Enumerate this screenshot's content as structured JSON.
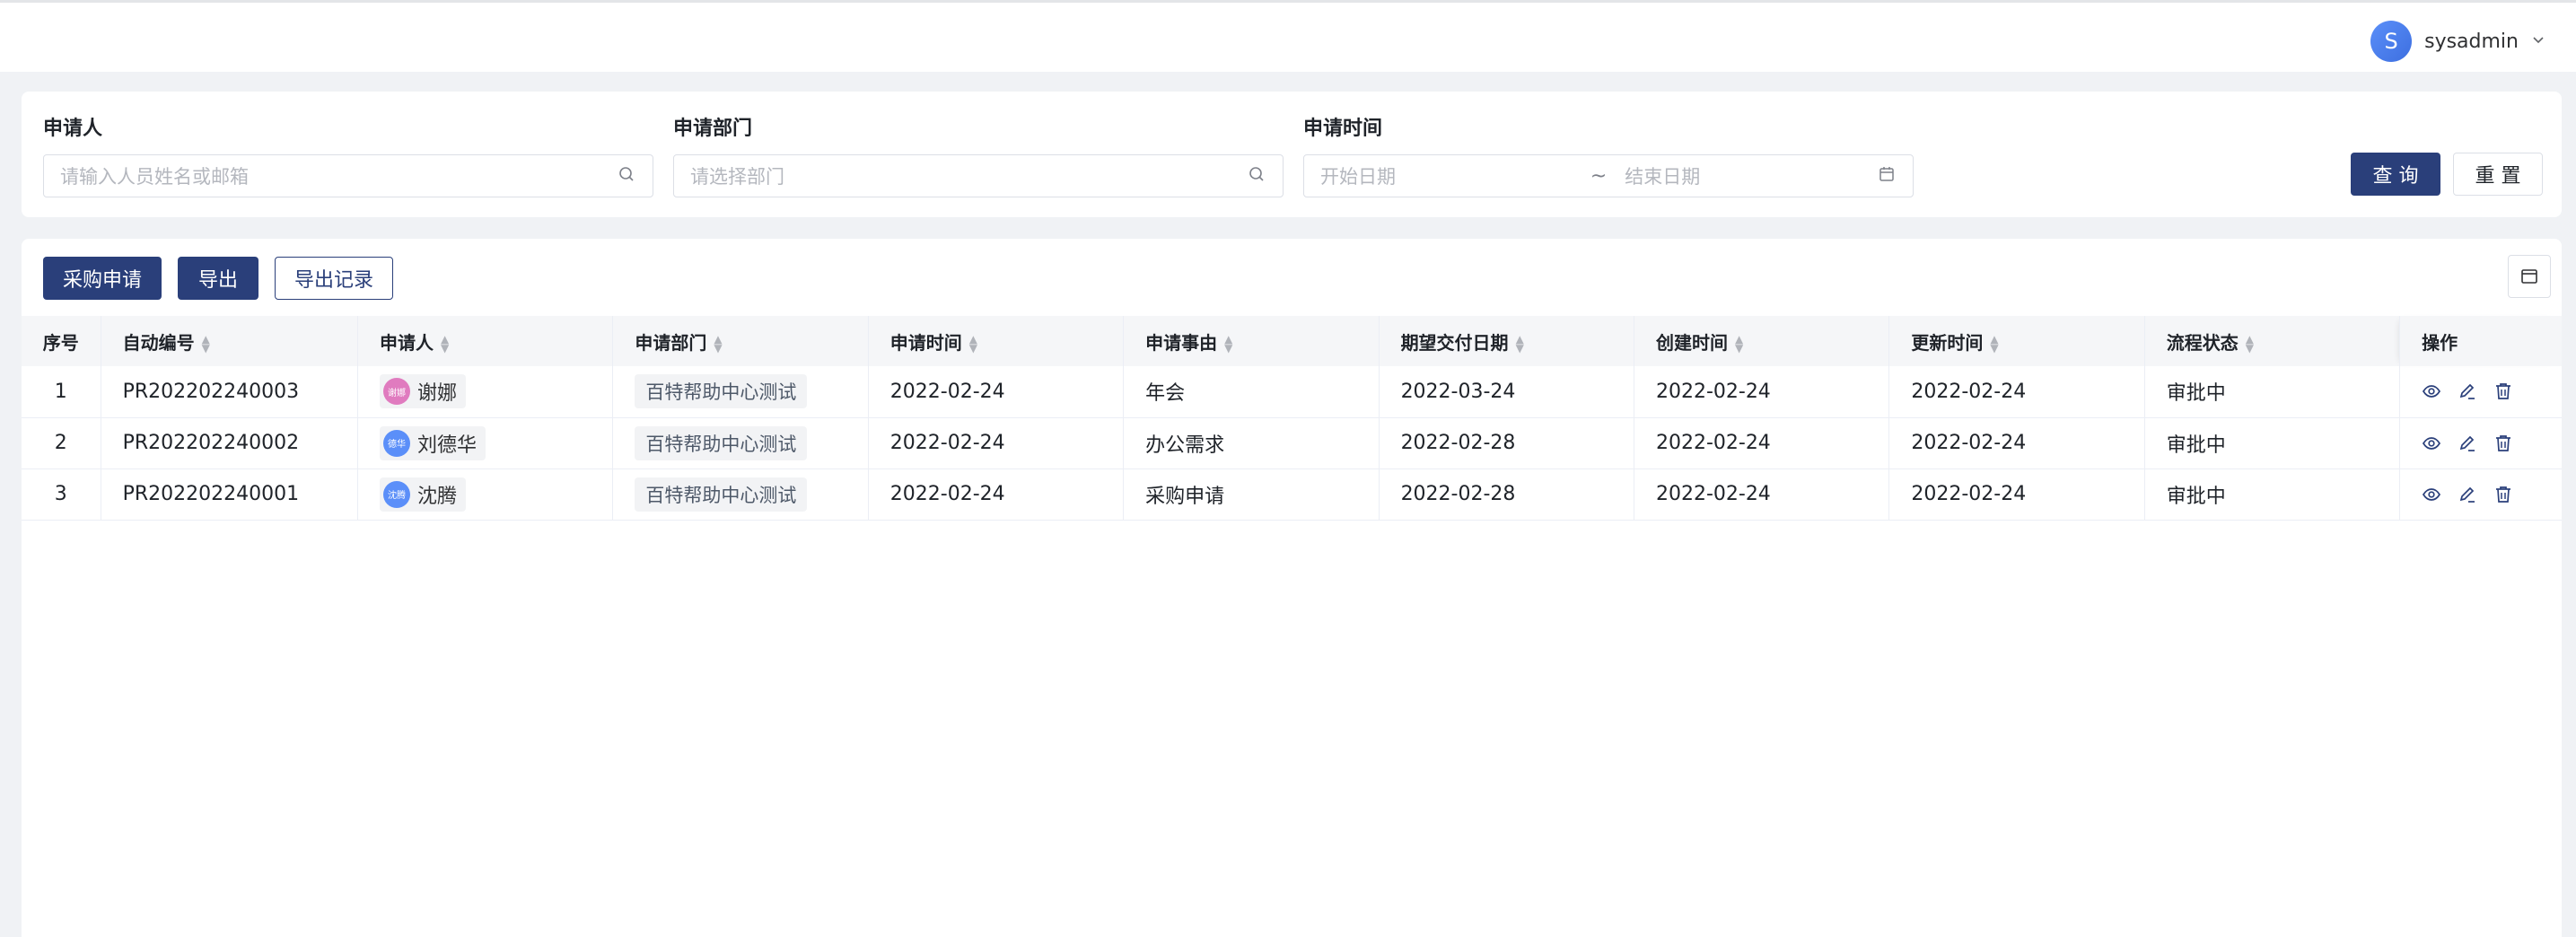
{
  "header": {
    "user": {
      "avatar_letter": "S",
      "name": "sysadmin"
    }
  },
  "filters": {
    "applicant": {
      "label": "申请人",
      "placeholder": "请输入人员姓名或邮箱"
    },
    "department": {
      "label": "申请部门",
      "placeholder": "请选择部门"
    },
    "date": {
      "label": "申请时间",
      "start_placeholder": "开始日期",
      "separator": "~",
      "end_placeholder": "结束日期"
    },
    "query_button": "查 询",
    "reset_button": "重 置"
  },
  "toolbar": {
    "purchase_request_button": "采购申请",
    "export_button": "导出",
    "export_history_button": "导出记录"
  },
  "table": {
    "columns": [
      "序号",
      "自动编号",
      "申请人",
      "申请部门",
      "申请时间",
      "申请事由",
      "期望交付日期",
      "创建时间",
      "更新时间",
      "流程状态",
      "操作"
    ],
    "rows": [
      {
        "index": "1",
        "code": "PR202202240003",
        "applicant_avatar": "谢娜",
        "applicant": "谢娜",
        "avatar_color": "#e07bbf",
        "department": "百特帮助中心测试",
        "apply_date": "2022-02-24",
        "reason": "年会",
        "expected_date": "2022-03-24",
        "created": "2022-02-24",
        "updated": "2022-02-24",
        "status": "审批中"
      },
      {
        "index": "2",
        "code": "PR202202240002",
        "applicant_avatar": "德华",
        "applicant": "刘德华",
        "avatar_color": "#5b8ff9",
        "department": "百特帮助中心测试",
        "apply_date": "2022-02-24",
        "reason": "办公需求",
        "expected_date": "2022-02-28",
        "created": "2022-02-24",
        "updated": "2022-02-24",
        "status": "审批中"
      },
      {
        "index": "3",
        "code": "PR202202240001",
        "applicant_avatar": "沈腾",
        "applicant": "沈腾",
        "avatar_color": "#5b8ff9",
        "department": "百特帮助中心测试",
        "apply_date": "2022-02-24",
        "reason": "采购申请",
        "expected_date": "2022-02-28",
        "created": "2022-02-24",
        "updated": "2022-02-24",
        "status": "审批中"
      }
    ]
  },
  "icons": [
    "search-icon",
    "calendar-icon",
    "chevron-down-icon",
    "sort-icon",
    "view-icon",
    "edit-icon",
    "delete-icon",
    "column-settings-icon"
  ],
  "colors": {
    "primary": "#2a3f7a",
    "background": "#f0f2f5"
  }
}
